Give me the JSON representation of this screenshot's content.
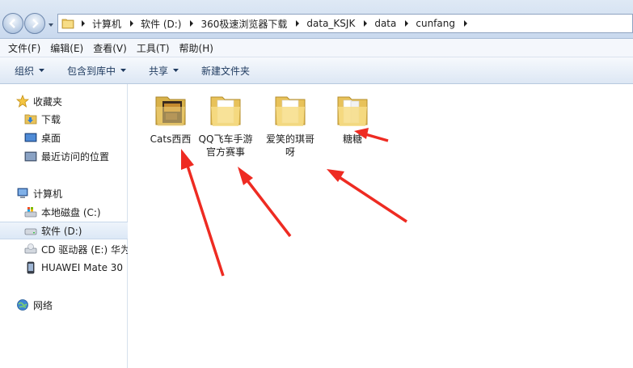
{
  "address": {
    "crumbs": [
      "计算机",
      "软件 (D:)",
      "360极速浏览器下载",
      "data_KSJK",
      "data",
      "cunfang"
    ]
  },
  "menu": [
    "文件(F)",
    "编辑(E)",
    "查看(V)",
    "工具(T)",
    "帮助(H)"
  ],
  "commands": {
    "organize": "组织",
    "include_library": "包含到库中",
    "share": "共享",
    "new_folder": "新建文件夹"
  },
  "nav": {
    "favorites": "收藏夹",
    "downloads": "下载",
    "desktop": "桌面",
    "recent": "最近访问的位置",
    "computer": "计算机",
    "drive_c": "本地磁盘 (C:)",
    "drive_d": "软件 (D:)",
    "drive_e": "CD 驱动器 (E:) 华为",
    "phone": "HUAWEI Mate 30",
    "network": "网络"
  },
  "folders": [
    {
      "name": "Cats西西"
    },
    {
      "name": "QQ飞车手游官方赛事"
    },
    {
      "name": "爱笑的琪哥呀"
    },
    {
      "name": "糖糖"
    }
  ],
  "colors": {
    "arrow": "#ee2b22",
    "folder": "#f5d26b",
    "accent": "#1e3a5f"
  }
}
